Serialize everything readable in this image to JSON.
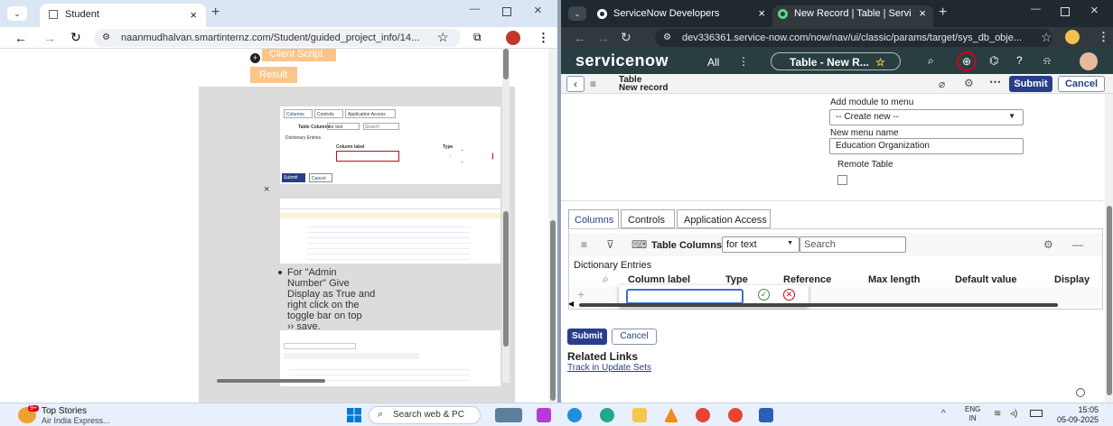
{
  "left_browser": {
    "tab_title": "Student",
    "url": "naanmudhalvan.smartinternz.com/Student/guided_project_info/14...",
    "client_script_label": "Client Script",
    "result_label": "Result",
    "close_x": "×",
    "instruction_lines": [
      "For \"Admin",
      "Number\" Give",
      "Display as True and",
      "right click on the",
      "toggle bar on top",
      "›› save."
    ],
    "embed1": {
      "tabs": [
        "Columns",
        "Controls",
        "Application Access"
      ],
      "toolbar_label": "Table Columns",
      "filter_value": "for text",
      "search_placeholder": "Search",
      "dictionary": "Dictionary Entries",
      "col_label": "Column label",
      "col_type": "Type",
      "submit": "Submit",
      "cancel": "Cancel"
    }
  },
  "right_browser": {
    "tabs": [
      {
        "title": "ServiceNow Developers"
      },
      {
        "title": "New Record | Table | ServiceN"
      }
    ],
    "url": "dev336361.service-now.com/now/nav/ui/classic/params/target/sys_db_obje...",
    "sn_logo": "servicenow",
    "all_label": "All",
    "context_pill": "Table - New R...",
    "form_title": "Table",
    "form_subtitle": "New record",
    "submit_top": "Submit",
    "cancel_top": "Cancel",
    "add_module_label": "Add module to menu",
    "add_module_value": "-- Create new --",
    "new_menu_name_label": "New menu name",
    "new_menu_name_value": "Education Organization",
    "remote_table_label": "Remote Table",
    "tabs_section": [
      "Columns",
      "Controls",
      "Application Access"
    ],
    "table_columns_label": "Table Columns",
    "filter_value": "for text",
    "search_placeholder": "Search",
    "dictionary_entries": "Dictionary Entries",
    "columns": [
      "Column label",
      "Type",
      "Reference",
      "Max length",
      "Default value",
      "Display"
    ],
    "submit_bottom": "Submit",
    "cancel_bottom": "Cancel",
    "related_links": "Related Links",
    "track_link": "Track in Update Sets"
  },
  "taskbar": {
    "news_badge": "9+",
    "news_title": "Top Stories",
    "news_sub": "Air India Express...",
    "search_placeholder": "Search web & PC",
    "lang_top": "ENG",
    "lang_bottom": "IN",
    "time": "15:05",
    "date": "05-09-2025"
  },
  "colors": {
    "sn_header": "#293e40",
    "sn_primary": "#293e8a",
    "orange_button": "#fbc58a",
    "error_red": "#d0021b"
  }
}
